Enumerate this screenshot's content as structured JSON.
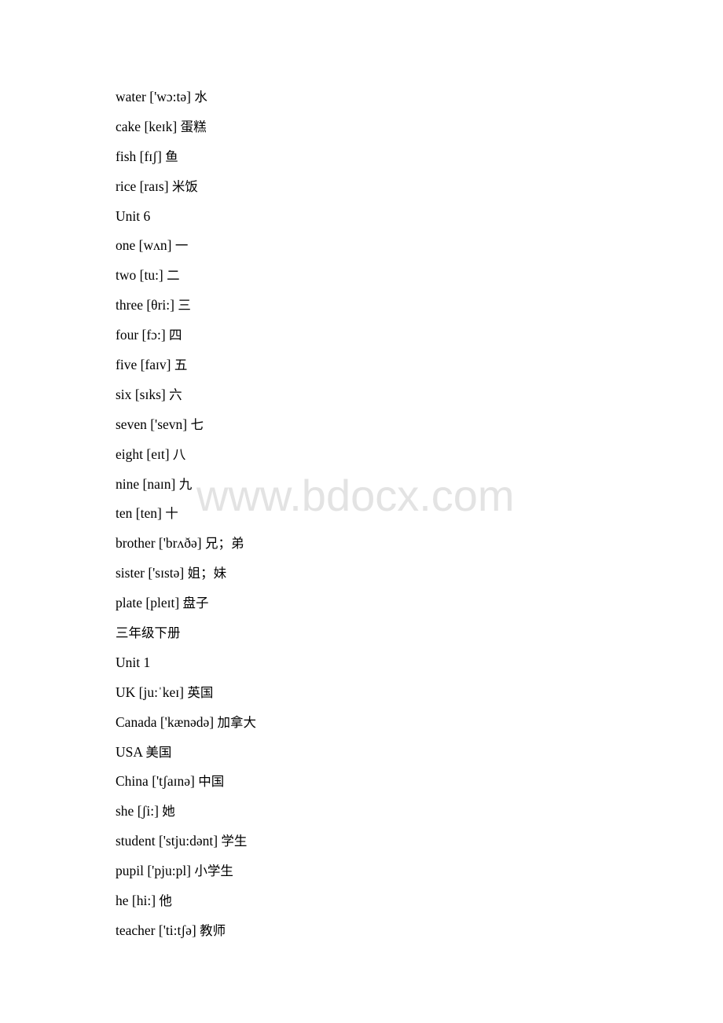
{
  "document": {
    "lines": [
      {
        "type": "entry",
        "word": "water",
        "phonetic": "['wɔ:tə]",
        "meaning": "水"
      },
      {
        "type": "entry",
        "word": "cake",
        "phonetic": "[keɪk]",
        "meaning": "蛋糕"
      },
      {
        "type": "entry",
        "word": "fish",
        "phonetic": "[fɪʃ]",
        "meaning": "鱼"
      },
      {
        "type": "entry",
        "word": "rice",
        "phonetic": "[raɪs]",
        "meaning": "米饭"
      },
      {
        "type": "heading",
        "text": "Unit 6"
      },
      {
        "type": "entry",
        "word": "one",
        "phonetic": "[wʌn]",
        "meaning": "一"
      },
      {
        "type": "entry",
        "word": "two",
        "phonetic": "[tu:]",
        "meaning": "二"
      },
      {
        "type": "entry",
        "word": "three",
        "phonetic": "[θri:]",
        "meaning": "三"
      },
      {
        "type": "entry",
        "word": "four",
        "phonetic": "[fɔ:]",
        "meaning": "四"
      },
      {
        "type": "entry",
        "word": "five",
        "phonetic": "[faɪv]",
        "meaning": "五"
      },
      {
        "type": "entry",
        "word": "six",
        "phonetic": "[sɪks]",
        "meaning": "六"
      },
      {
        "type": "entry",
        "word": "seven",
        "phonetic": "['sevn]",
        "meaning": "七"
      },
      {
        "type": "entry",
        "word": "eight",
        "phonetic": "[eɪt]",
        "meaning": "八"
      },
      {
        "type": "entry",
        "word": "nine",
        "phonetic": "[naɪn]",
        "meaning": "九"
      },
      {
        "type": "entry",
        "word": "ten",
        "phonetic": "[ten]",
        "meaning": "十"
      },
      {
        "type": "entry",
        "word": "brother",
        "phonetic": "['brʌðə]",
        "meaning": "兄；弟"
      },
      {
        "type": "entry",
        "word": "sister",
        "phonetic": "['sɪstə]",
        "meaning": "姐；妹"
      },
      {
        "type": "entry",
        "word": "plate",
        "phonetic": "[pleɪt]",
        "meaning": "盘子"
      },
      {
        "type": "heading",
        "text": "三年级下册"
      },
      {
        "type": "heading",
        "text": "Unit 1"
      },
      {
        "type": "entry",
        "word": "UK",
        "phonetic": "[ju:ˈkeɪ]",
        "meaning": "英国"
      },
      {
        "type": "entry",
        "word": "Canada",
        "phonetic": "['kænədə]",
        "meaning": "加拿大"
      },
      {
        "type": "entry",
        "word": "USA",
        "phonetic": "",
        "meaning": "美国"
      },
      {
        "type": "entry",
        "word": "China",
        "phonetic": "['tʃaɪnə]",
        "meaning": "中国"
      },
      {
        "type": "entry",
        "word": "she",
        "phonetic": "[ʃi:]",
        "meaning": "她"
      },
      {
        "type": "entry",
        "word": "student",
        "phonetic": "['stju:dənt]",
        "meaning": "学生"
      },
      {
        "type": "entry",
        "word": "pupil",
        "phonetic": "['pju:pl]",
        "meaning": "小学生"
      },
      {
        "type": "entry",
        "word": "he",
        "phonetic": "[hi:]",
        "meaning": "他"
      },
      {
        "type": "entry",
        "word": "teacher",
        "phonetic": "['ti:tʃə]",
        "meaning": "教师"
      }
    ]
  },
  "watermark": {
    "text": "www.bdocx.com",
    "color": "#e3e3e3"
  }
}
